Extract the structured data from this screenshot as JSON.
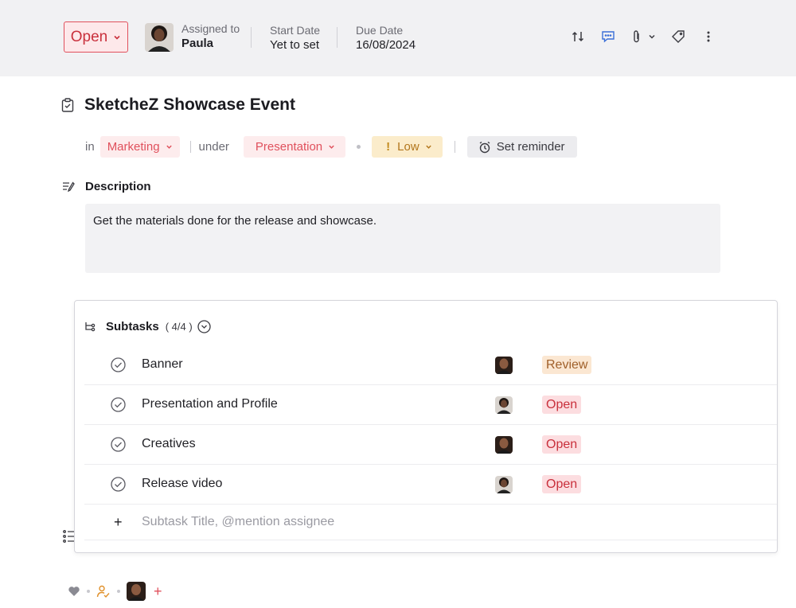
{
  "header": {
    "status": {
      "label": "Open",
      "color": "#c9303c"
    },
    "assignee": {
      "label": "Assigned to",
      "name": "Paula"
    },
    "start_date": {
      "label": "Start Date",
      "value": "Yet to set"
    },
    "due_date": {
      "label": "Due Date",
      "value": "16/08/2024"
    },
    "actions": [
      "repeat-icon",
      "comment-icon",
      "attachment-icon",
      "chevron-down-icon",
      "tag-icon",
      "more-vertical-icon"
    ]
  },
  "task": {
    "title": "SketcheZ Showcase Event",
    "in_label": "in",
    "project": "Marketing",
    "under_label": "under",
    "tasklist": "Presentation",
    "priority": "Low",
    "priority_mark": "!",
    "reminder": "Set reminder"
  },
  "description": {
    "heading": "Description",
    "text": "Get the materials done for the release and showcase."
  },
  "subtasks": {
    "title": "Subtasks",
    "count": "( 4/4 )",
    "items": [
      {
        "name": "Banner",
        "status": "Review",
        "status_type": "review",
        "assignee_avatar": "man"
      },
      {
        "name": "Presentation and Profile",
        "status": "Open",
        "status_type": "open",
        "assignee_avatar": "woman"
      },
      {
        "name": "Creatives",
        "status": "Open",
        "status_type": "open",
        "assignee_avatar": "man"
      },
      {
        "name": "Release video",
        "status": "Open",
        "status_type": "open",
        "assignee_avatar": "woman"
      }
    ],
    "add_placeholder": "Subtask Title, @mention assignee",
    "add_symbol": "+"
  },
  "footer": {
    "icons": [
      "heart-icon",
      "followers-icon",
      "avatar"
    ],
    "add_symbol": "+"
  }
}
